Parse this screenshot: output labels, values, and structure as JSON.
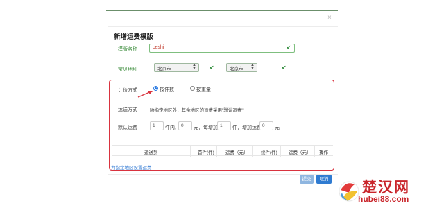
{
  "dialog": {
    "title": "新增运费模版",
    "close_glyph": "×"
  },
  "form": {
    "template_name": {
      "label": "模版名称",
      "value": "ceshi"
    },
    "shipping_address": {
      "label": "宝贝地址",
      "province": "北京市",
      "city": "北京市"
    },
    "pricing_method": {
      "label": "计价方式",
      "options": [
        {
          "label": "按件数",
          "selected": true
        },
        {
          "label": "按重量",
          "selected": false
        }
      ]
    },
    "shipping_method": {
      "label": "运送方式",
      "text": "除指定地区外，其余地区的运费采用\"默认运费\""
    },
    "default_fee": {
      "label": "默认运费",
      "first_qty": "1",
      "unit_pieces_within": "件内,",
      "first_fee": "0",
      "unit_yuan_each_add": "元，每增加",
      "add_qty": "1",
      "unit_pieces_add_fee": "件，增加运费",
      "add_fee": "0",
      "unit_yuan": "元"
    }
  },
  "table": {
    "headers": [
      "运送到",
      "首件(件)",
      "运费（元）",
      "续件(件)",
      "运费（元）",
      "操作"
    ]
  },
  "link_specify_region": "为指定地区设置运费",
  "buttons": {
    "submit": "提交",
    "cancel": "取消"
  },
  "watermark": {
    "brand": "楚汉网",
    "url": "hubei88.com"
  },
  "colors": {
    "accent_red": "#d9333f",
    "primary_blue": "#2f7bd1",
    "valid_green": "#2e8b3a"
  },
  "icons": {
    "valid": "check-icon",
    "select": "updown-arrows-icon",
    "close": "close-icon"
  }
}
